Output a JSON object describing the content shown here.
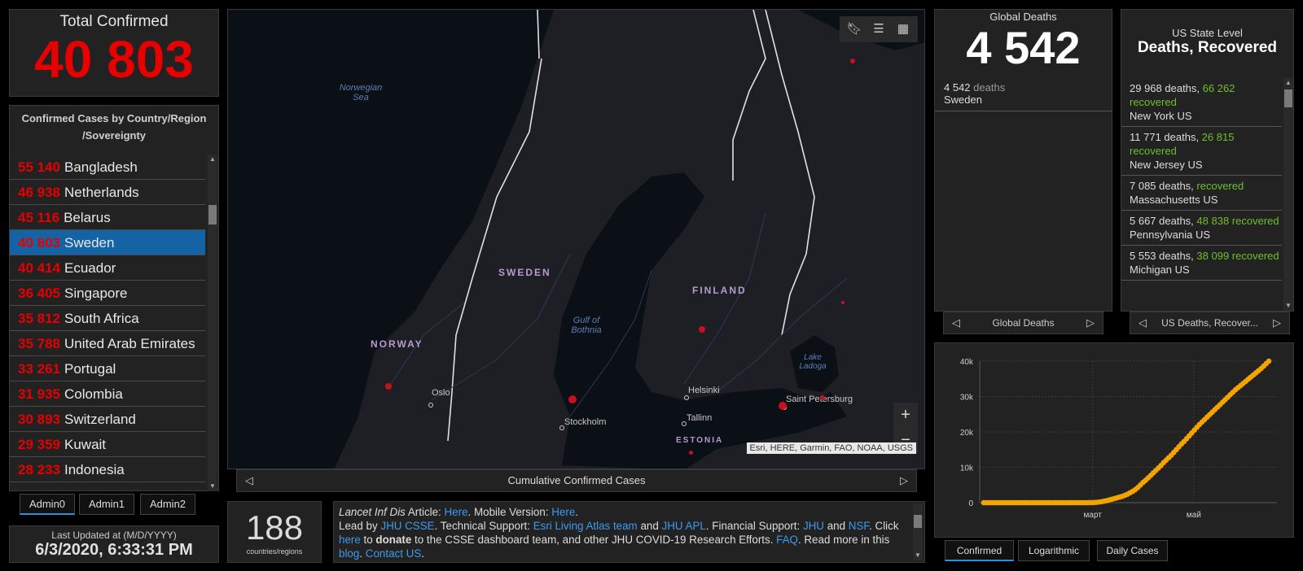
{
  "total": {
    "label": "Total Confirmed",
    "value": "40 803"
  },
  "countries": {
    "header": "Confirmed Cases by Country/Region /Sovereignty",
    "rows": [
      {
        "n": "55 140",
        "name": "Bangladesh"
      },
      {
        "n": "46 938",
        "name": "Netherlands"
      },
      {
        "n": "45 116",
        "name": "Belarus"
      },
      {
        "n": "40 803",
        "name": "Sweden"
      },
      {
        "n": "40 414",
        "name": "Ecuador"
      },
      {
        "n": "36 405",
        "name": "Singapore"
      },
      {
        "n": "35 812",
        "name": "South Africa"
      },
      {
        "n": "35 788",
        "name": "United Arab Emirates"
      },
      {
        "n": "33 261",
        "name": "Portugal"
      },
      {
        "n": "31 935",
        "name": "Colombia"
      },
      {
        "n": "30 893",
        "name": "Switzerland"
      },
      {
        "n": "29 359",
        "name": "Kuwait"
      },
      {
        "n": "28 233",
        "name": "Indonesia"
      }
    ],
    "selected_index": 3,
    "scroll_position": 0.13
  },
  "admin_tabs": [
    "Admin0",
    "Admin1",
    "Admin2"
  ],
  "updated": {
    "label": "Last Updated at (M/D/YYYY)",
    "value": "6/3/2020, 6:33:31 PM"
  },
  "map": {
    "caption": "Cumulative Confirmed Cases",
    "attribution": "Esri, HERE, Garmin, FAO, NOAA, USGS",
    "countries": [
      "SWEDEN",
      "FINLAND",
      "NORWAY",
      "ESTONIA"
    ],
    "water": [
      "Norwegian Sea",
      "Gulf of Bothnia",
      "Lake Ladoga"
    ],
    "cities": [
      "Oslo",
      "Stockholm",
      "Helsinki",
      "Tallinn",
      "Saint Petersburg"
    ]
  },
  "count": {
    "value": "188",
    "label": "countries/regions"
  },
  "info": {
    "p1": "Lancet Inf Dis",
    "p2": " Article: ",
    "here1": "Here",
    "p3": ". Mobile Version: ",
    "here2": "Here",
    "p4": ".",
    "p5": "Lead by ",
    "jhu_csse": "JHU CSSE",
    "p6": ". Technical Support: ",
    "esri": "Esri Living Atlas team",
    "p7": " and ",
    "jhu_apl": "JHU APL",
    "p8": ". Financial Support: ",
    "jhu": "JHU",
    "p9": " and",
    "nsf": "NSF",
    "p10": ". Click ",
    "here3": "here",
    "p11": " to ",
    "donate": "donate",
    "p12": " to the CSSE dashboard team, and other JHU COVID-19 Research Efforts. ",
    "faq": "FAQ",
    "p13": ". Read more in this ",
    "blog": "blog",
    "p14": ". ",
    "contact": "Contact US",
    "p15": "."
  },
  "global_deaths": {
    "title": "Global Deaths",
    "value": "4 542",
    "detail_num": "4 542",
    "detail_word": "deaths",
    "detail_place": "Sweden",
    "caption": "Global Deaths"
  },
  "us_state": {
    "title1": "US State Level",
    "title2": "Deaths, Recovered",
    "rows": [
      {
        "deaths": "29 968 deaths, ",
        "rec_num": "66 262",
        "rec": "recovered",
        "place": "New York US"
      },
      {
        "deaths": "11 771 deaths, ",
        "rec_num": "26 815",
        "rec": "recovered",
        "place": "New Jersey US"
      },
      {
        "deaths": "7 085 deaths, ",
        "rec_num": "",
        "rec": "recovered",
        "place": "Massachusetts US"
      },
      {
        "deaths": "5 667 deaths, ",
        "rec_num": "48 838",
        "rec": "recovered",
        "place": "Pennsylvania US"
      },
      {
        "deaths": "5 553 deaths, ",
        "rec_num": "38 099",
        "rec": "recovered",
        "place": "Michigan US"
      }
    ],
    "caption": "US Deaths, Recover..."
  },
  "chart_tabs": [
    "Confirmed",
    "Logarithmic",
    "Daily Cases"
  ],
  "colors": {
    "confirmed_red": "#e60000",
    "recovered_green": "#6fbf2a",
    "selected_blue": "#1464a5",
    "link_blue": "#3c9bf0",
    "chart_orange": "#f5a300"
  },
  "chart_data": {
    "type": "scatter",
    "x_labels": [
      "март",
      "май"
    ],
    "y_ticks": [
      "0",
      "10k",
      "20k",
      "30k",
      "40k"
    ],
    "ylim": [
      0,
      40000
    ],
    "grid": true,
    "points": [
      [
        0,
        0
      ],
      [
        1,
        0
      ],
      [
        2,
        0
      ],
      [
        3,
        0
      ],
      [
        4,
        0
      ],
      [
        5,
        0
      ],
      [
        6,
        0
      ],
      [
        7,
        0
      ],
      [
        8,
        0
      ],
      [
        9,
        0
      ],
      [
        10,
        0
      ],
      [
        11,
        0
      ],
      [
        12,
        0
      ],
      [
        13,
        0
      ],
      [
        14,
        0
      ],
      [
        15,
        0
      ],
      [
        16,
        0
      ],
      [
        17,
        0
      ],
      [
        18,
        0
      ],
      [
        19,
        0
      ],
      [
        20,
        0
      ],
      [
        21,
        0
      ],
      [
        22,
        0
      ],
      [
        23,
        0
      ],
      [
        24,
        0
      ],
      [
        25,
        0
      ],
      [
        26,
        0
      ],
      [
        27,
        0
      ],
      [
        28,
        0
      ],
      [
        29,
        0
      ],
      [
        30,
        0
      ],
      [
        31,
        0
      ],
      [
        32,
        0
      ],
      [
        33,
        0
      ],
      [
        34,
        0
      ],
      [
        35,
        0
      ],
      [
        36,
        0
      ],
      [
        37,
        0
      ],
      [
        38,
        0
      ],
      [
        39,
        0
      ],
      [
        40,
        0
      ],
      [
        41,
        10
      ],
      [
        42,
        20
      ],
      [
        43,
        50
      ],
      [
        44,
        100
      ],
      [
        45,
        200
      ],
      [
        46,
        300
      ],
      [
        47,
        450
      ],
      [
        48,
        600
      ],
      [
        49,
        800
      ],
      [
        50,
        1000
      ],
      [
        51,
        1200
      ],
      [
        52,
        1400
      ],
      [
        53,
        1600
      ],
      [
        54,
        1800
      ],
      [
        55,
        2100
      ],
      [
        56,
        2400
      ],
      [
        57,
        2800
      ],
      [
        58,
        3200
      ],
      [
        59,
        3700
      ],
      [
        60,
        4300
      ],
      [
        61,
        5000
      ],
      [
        62,
        5700
      ],
      [
        63,
        6300
      ],
      [
        64,
        7000
      ],
      [
        65,
        7700
      ],
      [
        66,
        8400
      ],
      [
        67,
        9100
      ],
      [
        68,
        9800
      ],
      [
        69,
        10500
      ],
      [
        70,
        11300
      ],
      [
        71,
        12000
      ],
      [
        72,
        12700
      ],
      [
        73,
        13400
      ],
      [
        74,
        14200
      ],
      [
        75,
        15000
      ],
      [
        76,
        15800
      ],
      [
        77,
        16600
      ],
      [
        78,
        17300
      ],
      [
        79,
        18100
      ],
      [
        80,
        18900
      ],
      [
        81,
        19700
      ],
      [
        82,
        20500
      ],
      [
        83,
        21300
      ],
      [
        84,
        22100
      ],
      [
        85,
        22800
      ],
      [
        86,
        23500
      ],
      [
        87,
        24200
      ],
      [
        88,
        24900
      ],
      [
        89,
        25600
      ],
      [
        90,
        26300
      ],
      [
        91,
        27000
      ],
      [
        92,
        27700
      ],
      [
        93,
        28400
      ],
      [
        94,
        29100
      ],
      [
        95,
        29800
      ],
      [
        96,
        30500
      ],
      [
        97,
        31200
      ],
      [
        98,
        31900
      ],
      [
        99,
        32500
      ],
      [
        100,
        33100
      ],
      [
        101,
        33700
      ],
      [
        102,
        34300
      ],
      [
        103,
        34900
      ],
      [
        104,
        35500
      ],
      [
        105,
        36100
      ],
      [
        106,
        36700
      ],
      [
        107,
        37300
      ],
      [
        108,
        37900
      ],
      [
        109,
        38600
      ],
      [
        110,
        39300
      ],
      [
        111,
        40000
      ]
    ]
  }
}
